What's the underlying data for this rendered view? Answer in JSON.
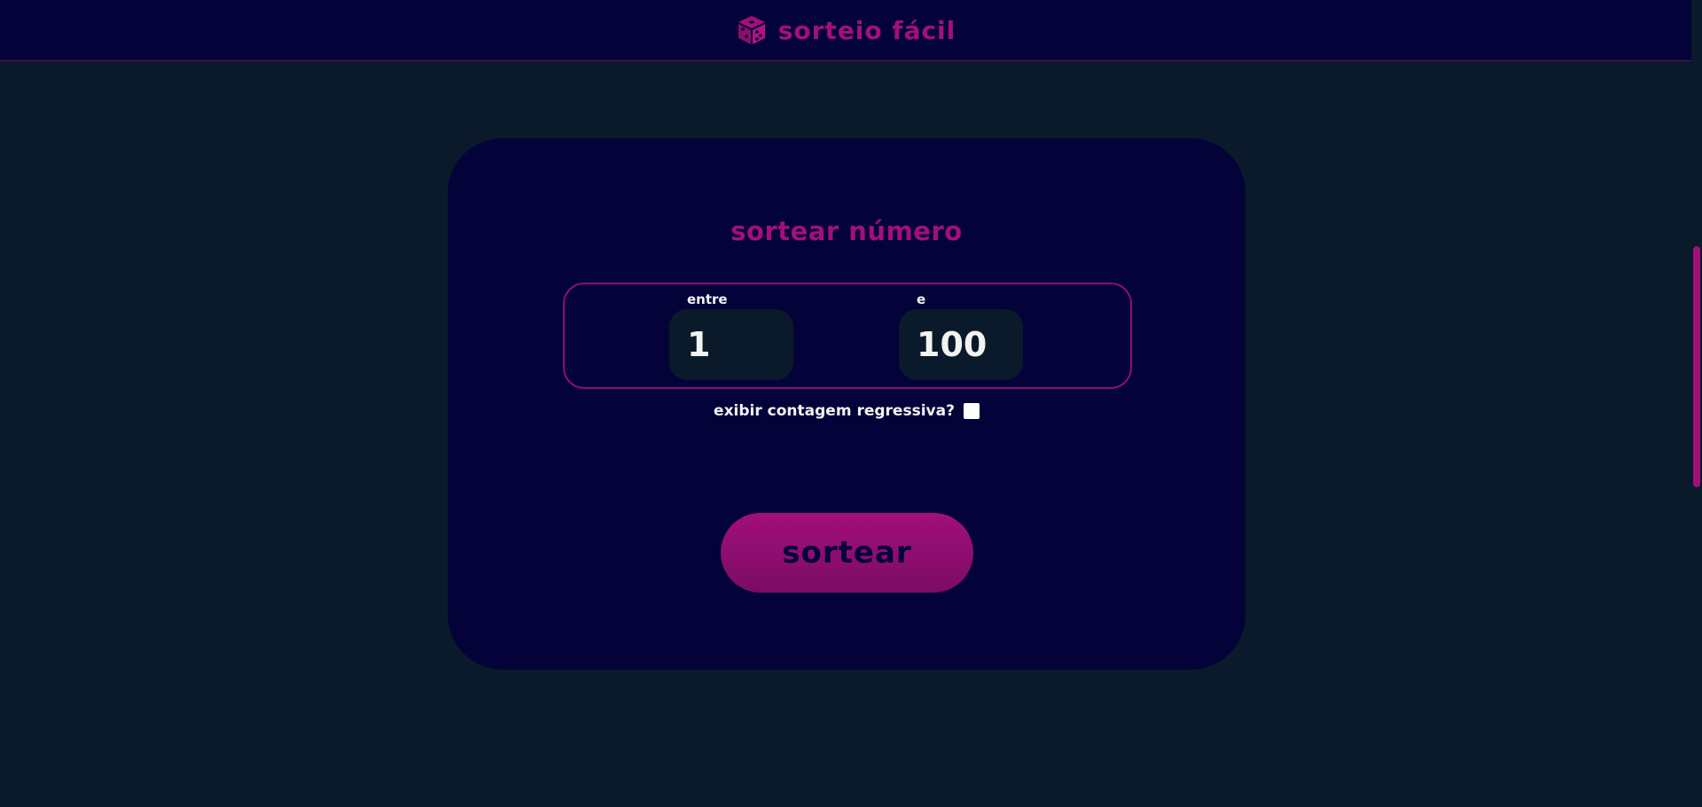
{
  "header": {
    "logo_icon": "dice-icon",
    "title": "sorteio fácil"
  },
  "card": {
    "title": "sortear número",
    "range": {
      "from_label": "entre",
      "from_value": "1",
      "to_label": "e",
      "to_value": "100"
    },
    "countdown": {
      "label": "exibir contagem regressiva?",
      "checked": false
    },
    "draw_button_label": "sortear"
  },
  "colors": {
    "background": "#0a1a2a",
    "panel": "#03033a",
    "accent": "#a30f78",
    "text": "#f2f2f2"
  }
}
